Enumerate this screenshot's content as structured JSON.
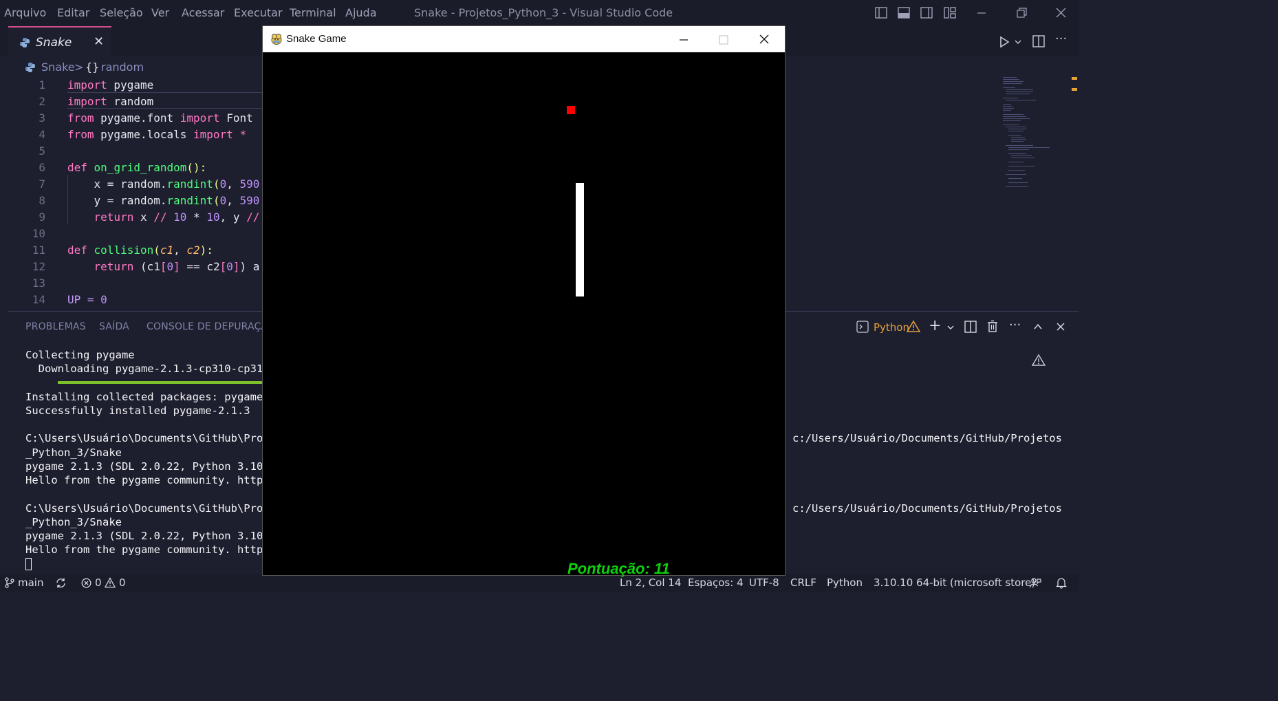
{
  "menu": [
    "Arquivo",
    "Editar",
    "Seleção",
    "Ver",
    "Acessar",
    "Executar",
    "Terminal",
    "Ajuda"
  ],
  "window_title": "Snake - Projetos_Python_3 - Visual Studio Code",
  "tab": {
    "label": "Snake",
    "close": "✕"
  },
  "breadcrumb": {
    "file": "Snake",
    "sep": ">",
    "symbol_icon": "{}",
    "symbol": "random"
  },
  "code_lines": [
    {
      "n": "1"
    },
    {
      "n": "2"
    },
    {
      "n": "3"
    },
    {
      "n": "4"
    },
    {
      "n": "5"
    },
    {
      "n": "6"
    },
    {
      "n": "7"
    },
    {
      "n": "8"
    },
    {
      "n": "9"
    },
    {
      "n": "10"
    },
    {
      "n": "11"
    },
    {
      "n": "12"
    },
    {
      "n": "13"
    },
    {
      "n": "14"
    }
  ],
  "code_text": {
    "l1_kw": "import",
    "l1_rest": " pygame",
    "l2_kw": "import",
    "l2_rest": " random",
    "l3_kw1": "from",
    "l3_mid": " pygame.font ",
    "l3_kw2": "import",
    "l3_rest": " Font",
    "l4_kw1": "from",
    "l4_mid": " pygame.locals ",
    "l4_kw2": "import",
    "l4_rest": " *",
    "l6_kw": "def",
    "l6_fn": " on_grid_random",
    "l6_rest": "():",
    "l7_a": "    x = random.",
    "l7_fn": "randint",
    "l7_b": "(",
    "l7_num": "0",
    "l7_c": ", ",
    "l7_num2": "590",
    "l8_a": "    y = random.",
    "l8_fn": "randint",
    "l8_b": "(",
    "l8_num": "0",
    "l8_c": ", ",
    "l8_num2": "590",
    "l9_kw": "    return",
    "l9_a": " x ",
    "l9_op": "//",
    "l9_num": " 10",
    "l9_b": " * ",
    "l9_num2": "10",
    "l9_c": ", y ",
    "l9_op2": "//",
    "l11_kw": "def",
    "l11_fn": " collision",
    "l11_p1": "(",
    "l11_a": "c1",
    "l11_c": ", ",
    "l11_b": "c2",
    "l11_p2": "):",
    "l12_kw": "    return",
    "l12_a": " (c1",
    "l12_br1": "[",
    "l12_n1": "0",
    "l12_br2": "]",
    "l12_b": " == c2",
    "l12_br3": "[",
    "l12_n2": "0",
    "l12_br4": "]",
    "l12_c": ") a",
    "l14_a": "UP = ",
    "l14_num": "0"
  },
  "panel": {
    "tabs": [
      "PROBLEMAS",
      "SAÍDA",
      "CONSOLE DE DEPURAÇÃO"
    ],
    "terminal_name": "Python"
  },
  "terminal": {
    "l1": "Collecting pygame",
    "l2": "  Downloading pygame-2.1.3-cp310-cp31",
    "l3": "Installing collected packages: pygame",
    "l4": "Successfully installed pygame-2.1.3",
    "l5": "C:\\Users\\Usuário\\Documents\\GitHub\\Pro",
    "l5r": "c:/Users/Usuário/Documents/GitHub/Projetos",
    "l6": "_Python_3/Snake",
    "l7": "pygame 2.1.3 (SDL 2.0.22, Python 3.10",
    "l8": "Hello from the pygame community. http",
    "l9": "C:\\Users\\Usuário\\Documents\\GitHub\\Pro",
    "l9r": "c:/Users/Usuário/Documents/GitHub/Projetos",
    "l10": "_Python_3/Snake",
    "l11": "pygame 2.1.3 (SDL 2.0.22, Python 3.10",
    "l12": "Hello from the pygame community. http",
    "cursor": " "
  },
  "status": {
    "branch": "main",
    "errors": "0",
    "warnings": "0",
    "position": "Ln 2, Col 14",
    "spaces": "Espaços: 4",
    "encoding": "UTF-8",
    "eol": "CRLF",
    "language": "Python",
    "interpreter": "3.10.10 64-bit (microsoft store)"
  },
  "game": {
    "title": "Snake Game",
    "score_text": "Pontuação: 11",
    "colors": {
      "apple": "#ff0000",
      "snake": "#ffffff",
      "score": "#0bd10b",
      "background": "#000000"
    }
  },
  "colors": {
    "accent": "#d04f8f",
    "editor_bg": "#1e1f2e",
    "keyword": "#ff79c6",
    "function": "#50fa7b",
    "number": "#bd93f9"
  }
}
